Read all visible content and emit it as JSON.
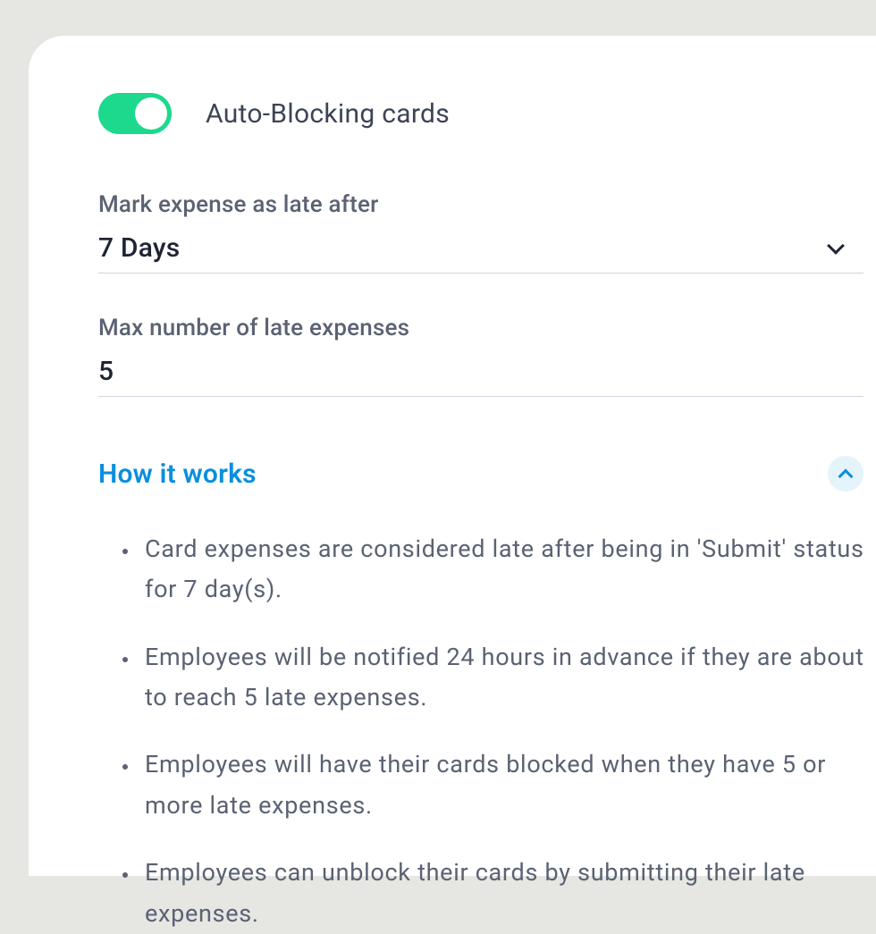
{
  "toggle": {
    "label": "Auto-Blocking cards",
    "checked": true
  },
  "markLate": {
    "label": "Mark expense as late after",
    "value": "7 Days"
  },
  "maxLate": {
    "label": "Max number of late expenses",
    "value": "5"
  },
  "howItWorks": {
    "title": "How it works",
    "expanded": true,
    "items": [
      "Card expenses are considered late after being in 'Submit' status for 7 day(s).",
      "Employees will be notified 24 hours in advance if they are about to reach 5 late expenses.",
      "Employees will have their cards blocked when they have 5 or more late expenses.",
      "Employees can unblock their cards by submitting their late expenses."
    ]
  }
}
